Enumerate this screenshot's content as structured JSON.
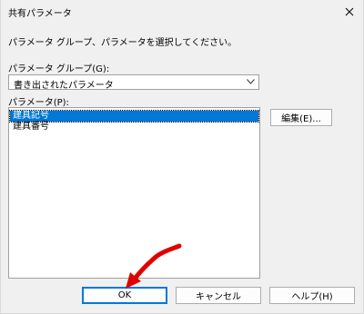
{
  "window": {
    "title": "共有パラメータ"
  },
  "instructions": "パラメータ グループ、パラメータを選択してください。",
  "group": {
    "label": "パラメータ グループ(G):",
    "selected": "書き出されたパラメータ"
  },
  "params": {
    "label": "パラメータ(P):",
    "items": [
      "建具記号",
      "建具番号"
    ],
    "selected_index": 0
  },
  "buttons": {
    "edit": "編集(E)...",
    "ok": "OK",
    "cancel": "キャンセル",
    "help": "ヘルプ(H)"
  },
  "colors": {
    "selection": "#0078d7",
    "annotation_arrow": "#e00000"
  }
}
